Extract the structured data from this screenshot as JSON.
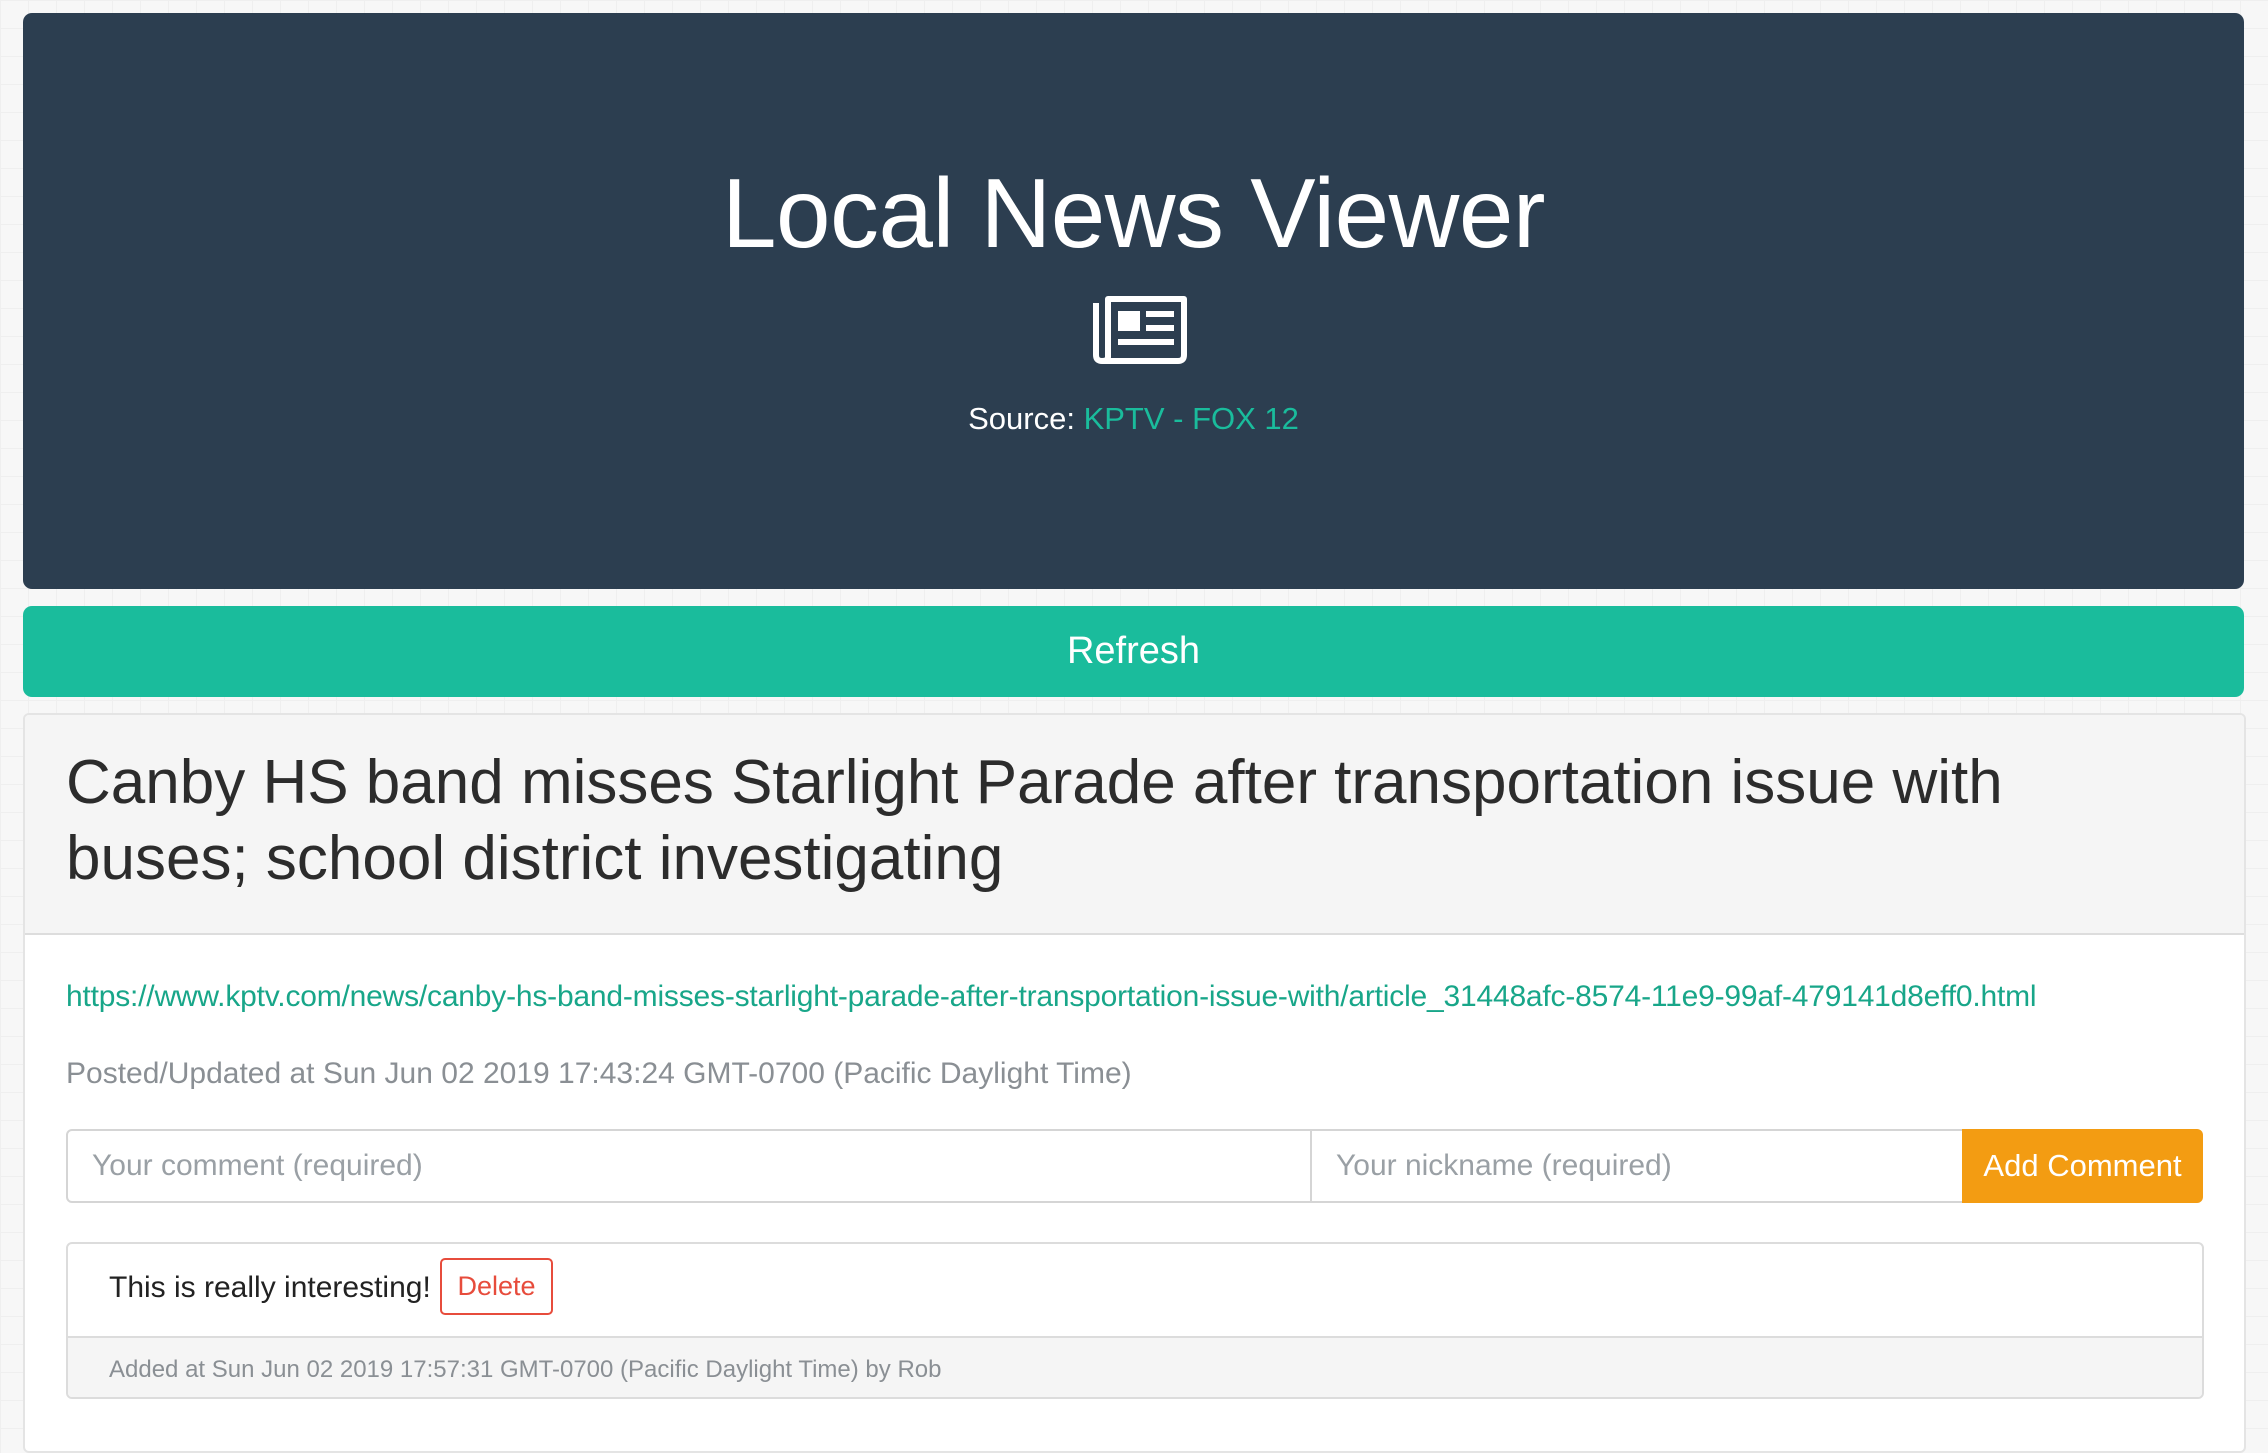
{
  "header": {
    "title": "Local News Viewer",
    "icon": "newspaper-icon",
    "source_label": "Source:",
    "source_name": "KPTV - FOX 12"
  },
  "toolbar": {
    "refresh_label": "Refresh"
  },
  "article": {
    "title": "Canby HS band misses Starlight Parade after transportation issue with buses; school district investigating",
    "url": "https://www.kptv.com/news/canby-hs-band-misses-starlight-parade-after-transportation-issue-with/article_31448afc-8574-11e9-99af-479141d8eff0.html",
    "posted": "Posted/Updated at Sun Jun 02 2019 17:43:24 GMT-0700 (Pacific Daylight Time)",
    "comment_form": {
      "comment_placeholder": "Your comment (required)",
      "comment_value": "",
      "nickname_placeholder": "Your nickname (required)",
      "nickname_value": "",
      "add_label": "Add Comment"
    },
    "comments": [
      {
        "text": "This is really interesting!",
        "delete_label": "Delete",
        "meta": "Added at Sun Jun 02 2019 17:57:31 GMT-0700 (Pacific Daylight Time) by Rob"
      }
    ]
  },
  "colors": {
    "header_bg": "#2c3e50",
    "accent": "#1abc9c",
    "add_button": "#f39c12",
    "delete": "#e74c3c"
  }
}
